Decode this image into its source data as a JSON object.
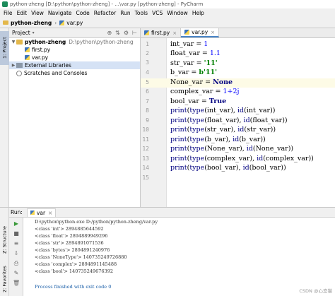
{
  "window": {
    "title": "python-zheng [D:\\python\\python-zheng] - ...\\var.py [python-zheng] - PyCharm"
  },
  "menu": [
    "File",
    "Edit",
    "View",
    "Navigate",
    "Code",
    "Refactor",
    "Run",
    "Tools",
    "VCS",
    "Window",
    "Help"
  ],
  "breadcrumb": {
    "project": "python-zheng",
    "file": "var.py"
  },
  "left_tabs": {
    "project": "1: Project",
    "structure": "Z: Structure",
    "favorites": "2: Favorites"
  },
  "project_panel": {
    "title": "Project",
    "tree": [
      {
        "label": "python-zheng",
        "path": "D:\\python\\python-zheng",
        "kind": "folder"
      },
      {
        "label": "first.py",
        "kind": "py"
      },
      {
        "label": "var.py",
        "kind": "py"
      },
      {
        "label": "External Libraries",
        "kind": "lib"
      },
      {
        "label": "Scratches and Consoles",
        "kind": "scratch"
      }
    ]
  },
  "editor_tabs": [
    {
      "label": "first.py",
      "active": false
    },
    {
      "label": "var.py",
      "active": true
    }
  ],
  "code_lines": [
    "int_var = 1",
    "float_var = 1.1",
    "str_var = '11'",
    "b_var = b'11'",
    "None_var = None",
    "complex_var = 1+2j",
    "bool_var = True",
    "print(type(int_var), id(int_var))",
    "print(type(float_var), id(float_var))",
    "print(type(str_var), id(str_var))",
    "print(type(b_var), id(b_var))",
    "print(type(None_var), id(None_var))",
    "print(type(complex_var), id(complex_var))",
    "print(type(bool_var), id(bool_var))"
  ],
  "line_numbers": [
    "1",
    "2",
    "3",
    "4",
    "5",
    "6",
    "7",
    "8",
    "9",
    "10",
    "11",
    "12",
    "13",
    "14",
    "15"
  ],
  "run": {
    "label": "Run:",
    "tab": "var",
    "output": [
      "D:\\python\\python.exe D:/python/python-zheng/var.py",
      "<class 'int'> 2894885644592",
      "<class 'float'> 2894889949296",
      "<class 'str'> 2894891071536",
      "<class 'bytes'> 2894891240976",
      "<class 'NoneType'> 140735249726880",
      "<class 'complex'> 2894891145488",
      "<class 'bool'> 140735249676392",
      "",
      "Process finished with exit code 0"
    ]
  },
  "watermark": "CSDN @心恋猫"
}
